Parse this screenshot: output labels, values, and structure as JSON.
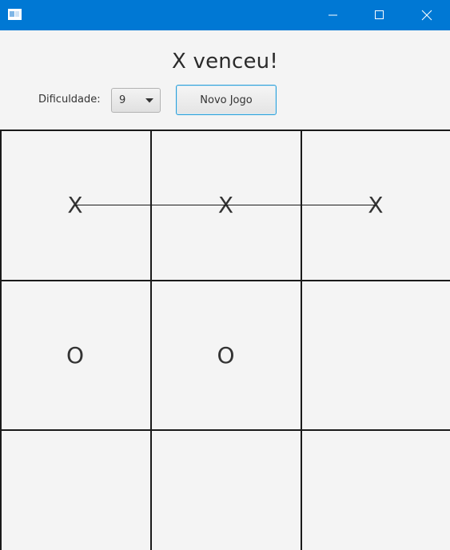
{
  "window": {
    "title_bar_color": "#0078d4",
    "icons": {
      "app": "app-window-icon",
      "minimize": "minimize-icon",
      "maximize": "maximize-icon",
      "close": "close-icon"
    }
  },
  "header": {
    "status": "X venceu!",
    "difficulty_label": "Dificuldade:",
    "difficulty_value": "9",
    "new_game_label": "Novo Jogo"
  },
  "board": {
    "cells": [
      [
        "X",
        "X",
        "X"
      ],
      [
        "O",
        "O",
        ""
      ],
      [
        "",
        "",
        ""
      ]
    ],
    "winning_row": 0,
    "winner": "X"
  }
}
